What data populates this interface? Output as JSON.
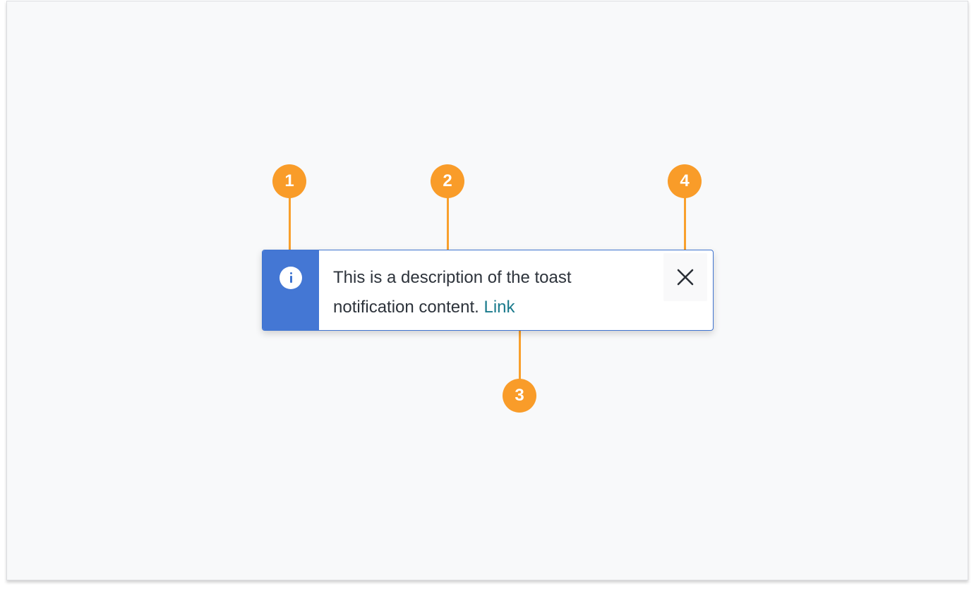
{
  "toast": {
    "message": "This is a description of the toast notification content.",
    "link_label": "Link",
    "kind": "info",
    "icon": "info-icon",
    "close_icon": "close-icon"
  },
  "callouts": [
    {
      "label": "1",
      "target": "icon"
    },
    {
      "label": "2",
      "target": "message"
    },
    {
      "label": "3",
      "target": "link"
    },
    {
      "label": "4",
      "target": "close-button"
    }
  ],
  "colors": {
    "background": "#f8f9fa",
    "toast_accent": "#4477d4",
    "toast_border": "#3f74d0",
    "link": "#1a7a8c",
    "text": "#2d333b",
    "callout": "#f99c29"
  }
}
